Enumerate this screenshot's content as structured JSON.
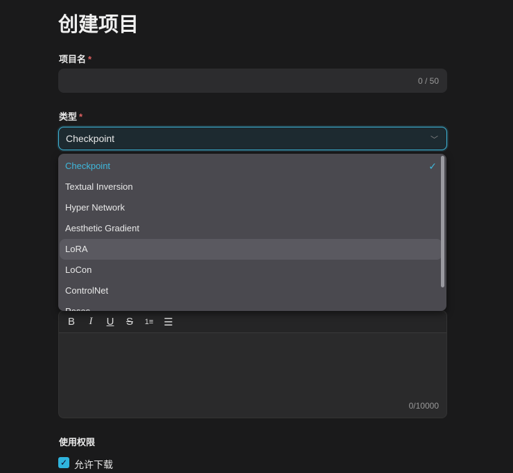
{
  "title": "创建项目",
  "name_field": {
    "label": "项目名",
    "required_mark": "*",
    "counter": "0 / 50"
  },
  "type_field": {
    "label": "类型",
    "required_mark": "*",
    "value": "Checkpoint",
    "chevron_icon": "chevron-down-icon"
  },
  "type_options": [
    "Checkpoint",
    "Textual Inversion",
    "Hyper Network",
    "Aesthetic Gradient",
    "LoRA",
    "LoCon",
    "ControlNet",
    "Poses"
  ],
  "selected_mark": "✓",
  "editor": {
    "toolbar": [
      "B",
      "I",
      "U",
      "S",
      "1≡",
      "☰"
    ],
    "counter": "0/10000"
  },
  "permissions": {
    "label": "使用权限",
    "allow_download": "允许下载",
    "allow_download_checked": true
  },
  "colors": {
    "accent": "#3fb8dc",
    "required": "#e06060"
  }
}
